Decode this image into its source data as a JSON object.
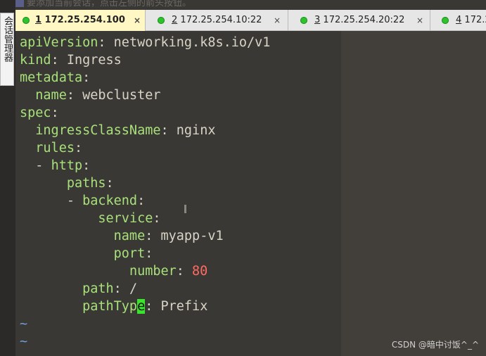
{
  "side_panel": {
    "label": "会话管理器"
  },
  "hint_bar": {
    "text": "要添加当前会话，点击左侧的箭头按钮。"
  },
  "tabs": [
    {
      "num": "1",
      "label": "172.25.254.100",
      "close": "×",
      "active": true
    },
    {
      "num": "2",
      "label": "172.25.254.10:22",
      "close": "×",
      "active": false
    },
    {
      "num": "3",
      "label": "172.25.254.20:22",
      "close": "×",
      "active": false
    },
    {
      "num": "4",
      "label": "172.2",
      "close": "",
      "active": false
    }
  ],
  "colors": {
    "terminal_bg": "#3a3835",
    "key": "#a8e07a",
    "text": "#d8d4c6",
    "number": "#ff6a63",
    "tilde": "#6fa0d8",
    "cursor": "#39e52a",
    "active_tab": "#fff7c4",
    "status_dot": "#2fc22f"
  },
  "editor": {
    "lines": [
      {
        "indent": "",
        "key": "apiVersion",
        "sep": ": ",
        "value": "networking.k8s.io/v1"
      },
      {
        "indent": "",
        "key": "kind",
        "sep": ": ",
        "value": "Ingress"
      },
      {
        "indent": "",
        "key": "metadata",
        "sep": ":",
        "value": ""
      },
      {
        "indent": "  ",
        "key": "name",
        "sep": ": ",
        "value": "webcluster"
      },
      {
        "indent": "",
        "key": "spec",
        "sep": ":",
        "value": ""
      },
      {
        "indent": "  ",
        "key": "ingressClassName",
        "sep": ": ",
        "value": "nginx"
      },
      {
        "indent": "  ",
        "key": "rules",
        "sep": ":",
        "value": ""
      },
      {
        "indent": "  - ",
        "key": "http",
        "sep": ":",
        "value": ""
      },
      {
        "indent": "      ",
        "key": "paths",
        "sep": ":",
        "value": ""
      },
      {
        "indent": "      - ",
        "key": "backend",
        "sep": ":",
        "value": ""
      },
      {
        "indent": "          ",
        "key": "service",
        "sep": ":",
        "value": ""
      },
      {
        "indent": "            ",
        "key": "name",
        "sep": ": ",
        "value": "myapp-v1"
      },
      {
        "indent": "            ",
        "key": "port",
        "sep": ":",
        "value": ""
      },
      {
        "indent": "              ",
        "key": "number",
        "sep": ": ",
        "value": "",
        "num": "80"
      },
      {
        "indent": "        ",
        "key": "path",
        "sep": ": ",
        "value": "/"
      }
    ],
    "cursor_line": {
      "indent": "        ",
      "key_before": "pathTyp",
      "cursor_char": "e",
      "sep": ": ",
      "value": "Prefix"
    },
    "empty_marker": "~"
  },
  "watermark": "CSDN @暗中讨饭^_^"
}
